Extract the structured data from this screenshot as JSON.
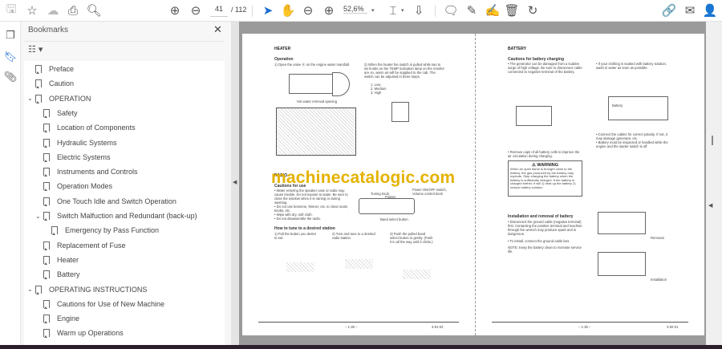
{
  "toolbar": {
    "page_current": "41",
    "page_total": "/ 112",
    "zoom": "52,6%",
    "icons": [
      "save-icon",
      "star-icon",
      "cloud-upload-icon",
      "print-icon",
      "zoom-search-icon",
      "page-up-icon",
      "page-down-icon",
      "select-cursor-icon",
      "hand-icon",
      "zoom-out-icon",
      "zoom-in-icon",
      "page-fit-icon",
      "scroll-mode-icon",
      "comment-icon",
      "highlight-icon",
      "sign-icon",
      "delete-icon",
      "rotate-icon",
      "share-link-icon",
      "email-icon",
      "add-user-icon"
    ]
  },
  "rail": {
    "icons": [
      "pages-icon",
      "bookmark-icon",
      "attachment-icon"
    ]
  },
  "panel": {
    "title": "Bookmarks",
    "close": "✕",
    "items": [
      {
        "label": "Preface",
        "level": 0,
        "toggle": ""
      },
      {
        "label": "Caution",
        "level": 0,
        "toggle": ""
      },
      {
        "label": "OPERATION",
        "level": 0,
        "toggle": "⌄"
      },
      {
        "label": "Safety",
        "level": 1,
        "toggle": ""
      },
      {
        "label": "Location of Components",
        "level": 1,
        "toggle": ""
      },
      {
        "label": "Hydraulic Systems",
        "level": 1,
        "toggle": ""
      },
      {
        "label": "Electric Systems",
        "level": 1,
        "toggle": ""
      },
      {
        "label": "Instruments and Controls",
        "level": 1,
        "toggle": ""
      },
      {
        "label": "Operation Modes",
        "level": 1,
        "toggle": ""
      },
      {
        "label": "One Touch Idle and Switch Operation",
        "level": 1,
        "toggle": ""
      },
      {
        "label": "Switch Malfuction and Redundant (back-up)",
        "level": 1,
        "toggle": "⌄"
      },
      {
        "label": "Emergency by Pass Function",
        "level": 2,
        "toggle": ""
      },
      {
        "label": "Replacement of Fuse",
        "level": 1,
        "toggle": ""
      },
      {
        "label": "Heater",
        "level": 1,
        "toggle": ""
      },
      {
        "label": "Battery",
        "level": 1,
        "toggle": ""
      },
      {
        "label": "OPERATING INSTRUCTIONS",
        "level": 0,
        "toggle": "⌄"
      },
      {
        "label": "Cautions for Use of New Machine",
        "level": 1,
        "toggle": ""
      },
      {
        "label": "Engine",
        "level": 1,
        "toggle": ""
      },
      {
        "label": "Warm up Operations",
        "level": 1,
        "toggle": ""
      }
    ]
  },
  "doc": {
    "watermark": "machinecatalogic.com",
    "left_page": {
      "title": "HEATER",
      "operation": "Operation",
      "step1": "1)  Open the valve Ⓐ on the engine water manifold",
      "step2": "2)  When the heater fan switch is pulled while two to six knobs on the TEMP indication lamp on the monitor are on, warm air will be supplied to the cab. The switch can be adjusted in three steps.",
      "levels": [
        "1. Low",
        "2. Medium",
        "3. High"
      ],
      "fig_label": "Hot water removal opening",
      "radio": "RADIO",
      "cautions": "Cautions for use",
      "caution_items": [
        "• Water entering the speaker case or radio may cause trouble. Do not expose to water. Be sure to close the window when it is raining or during washing.",
        "• Do not use benzene, thinner, etc. to clean scale, knobs, etc.",
        "• Wipe with dry, soft cloth.",
        "• Do not disassemble the radio."
      ],
      "radio_labels": [
        "Tuning knob",
        "Pointer",
        "Power ON/OFF switch, Volume control knob",
        "Band select button"
      ],
      "tune_title": "How to tune to a desired station",
      "tune_steps": [
        "1)  Pull the button you desire to set.",
        "2)  Turn and tune to a desired radio station.",
        "3)  Push the pulled band select button in gently. (Push it in all the way until it clicks.)"
      ],
      "page_no": "– 1-39 –",
      "code": "3-91-02"
    },
    "right_page": {
      "title": "BATTERY",
      "charging": "Cautions for battery charging",
      "items_a": [
        "• The generator can be damaged from a sudden surge of high voltage. Be sure to disconnect cable connected to negative terminal of the battery.",
        "• If your clothing is soaked with battery solution, wash in water as soon as possible."
      ],
      "items_b": [
        "• Connect the cables for correct polarity. If not, it may damage generator, etc.",
        "• Battery must be inspected or handled while the engine and the starter switch is off."
      ],
      "item_caps": "• Remove caps of all battery cells to improve the air circulation during charging.",
      "warning": "⚠ WARNING",
      "warning_text": "When an open flame is brought close to the battery, the gas produced by the battery may explode. Stop charging the battery when the battery is sufficiently charged. If the battery is charged further, it will 1) heat up the battery 2) reduce battery solution",
      "install": "Installation and removal of battery",
      "install_items": [
        "• Disconnect the ground cable (negative terminal) first. Contacting the positive terminal and machine through the wrench may produce spark and is dangerous.",
        "• To install, connect the ground cable last."
      ],
      "note": "NOTE:  Keep the battery clean to increase service life.",
      "fig_labels": [
        "Battery",
        "Removal",
        "Installation"
      ],
      "page_no": "– 1-35 –",
      "code": "3-92-01"
    }
  }
}
